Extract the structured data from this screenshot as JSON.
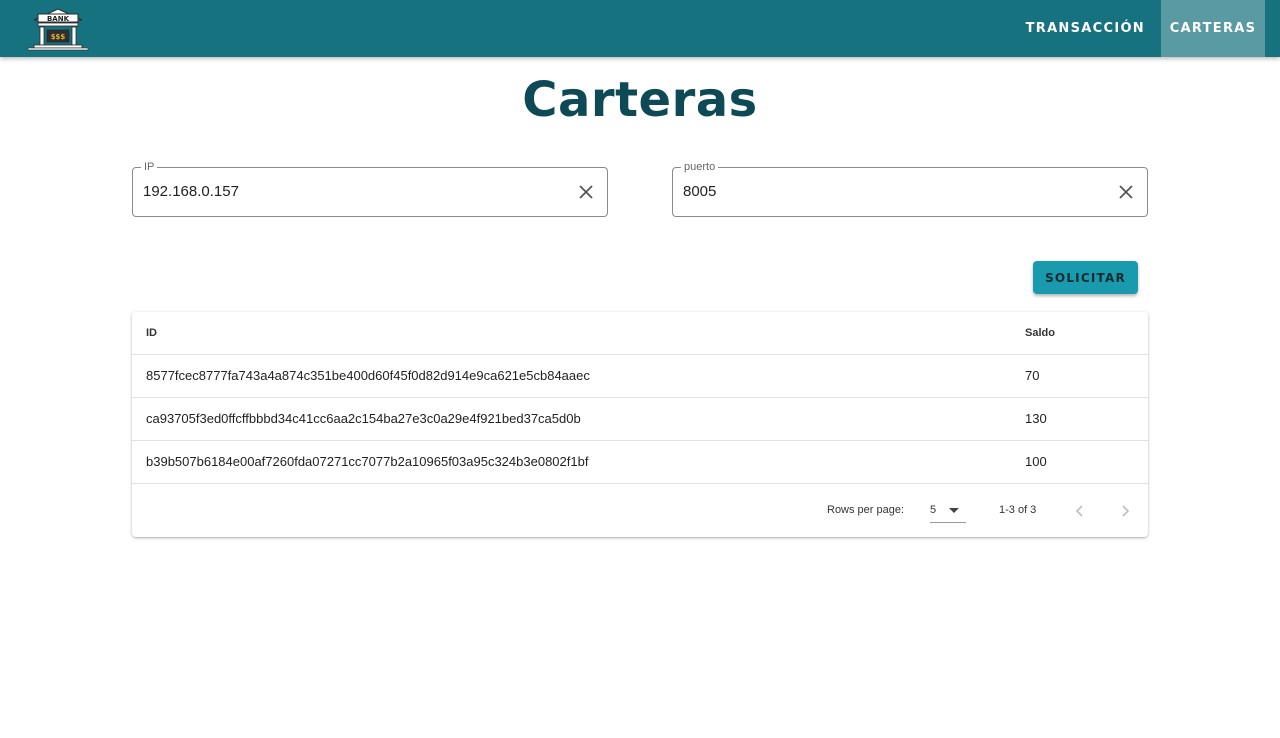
{
  "app": {
    "logo_text": "BANK",
    "logo_sign": "$$$"
  },
  "nav": {
    "items": [
      {
        "label": "TRANSACCIÓN"
      },
      {
        "label": "CARTERAS"
      }
    ]
  },
  "page": {
    "title": "Carteras"
  },
  "form": {
    "ip": {
      "label": "IP",
      "value": "192.168.0.157"
    },
    "port": {
      "label": "puerto",
      "value": "8005"
    },
    "submit_label": "SOLICITAR"
  },
  "table": {
    "columns": [
      "ID",
      "Saldo"
    ],
    "rows": [
      {
        "id": "8577fcec8777fa743a4a874c351be400d60f45f0d82d914e9ca621e5cb84aaec",
        "saldo": "70"
      },
      {
        "id": "ca93705f3ed0ffcffbbbd34c41cc6aa2c154ba27e3c0a29e4f921bed37ca5d0b",
        "saldo": "130"
      },
      {
        "id": "b39b507b6184e00af7260fda07271cc7077b2a10965f03a95c324b3e0802f1bf",
        "saldo": "100"
      }
    ],
    "footer": {
      "rows_per_page_label": "Rows per page:",
      "rows_per_page_value": "5",
      "range_text": "1-3 of 3"
    }
  },
  "colors": {
    "topbar": "#16727f",
    "nav_active": "#5a9aa2",
    "title": "#0d4a55",
    "button": "#1a9aad"
  },
  "icons": {
    "logo": "bank-building-icon",
    "clear": "close-icon",
    "dropdown": "caret-down-icon",
    "prev": "chevron-left-icon",
    "next": "chevron-right-icon"
  }
}
